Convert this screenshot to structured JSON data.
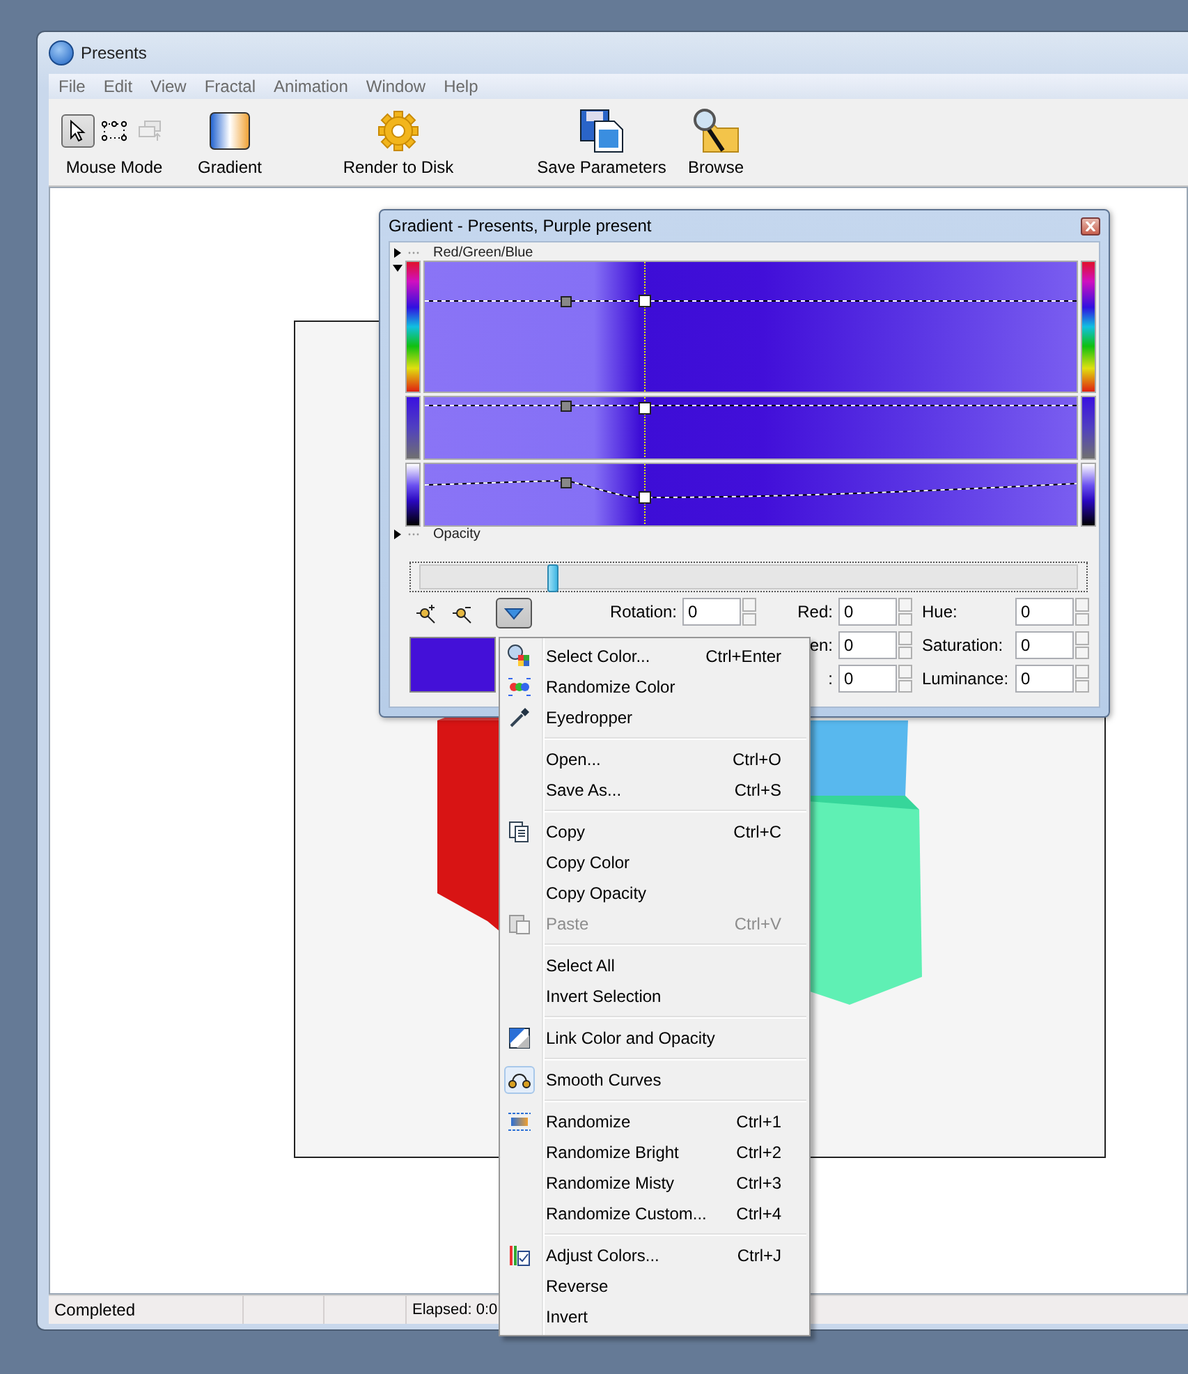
{
  "window": {
    "title": "Presents"
  },
  "menu_bar": [
    "File",
    "Edit",
    "View",
    "Fractal",
    "Animation",
    "Window",
    "Help"
  ],
  "toolbar": {
    "mouse_mode": {
      "label": "Mouse Mode",
      "tools": [
        {
          "selected": true,
          "disabled": false
        },
        {
          "selected": false,
          "disabled": false
        },
        {
          "selected": false,
          "disabled": true
        }
      ]
    },
    "buttons": [
      {
        "kind": "gradient",
        "label": "Gradient"
      },
      {
        "kind": "render",
        "label": "Render to Disk"
      },
      {
        "kind": "save",
        "label": "Save Parameters"
      },
      {
        "kind": "browse",
        "label": "Browse"
      }
    ]
  },
  "status_bar": {
    "status": "Completed",
    "elapsed": "Elapsed: 0:0"
  },
  "gradient_window": {
    "title": "Gradient - Presents, Purple present",
    "sections": [
      {
        "label": "Red/Green/Blue",
        "expanded": true
      },
      {
        "label": "Opacity",
        "expanded": false
      }
    ],
    "channels": [
      {
        "kind": "hue"
      },
      {
        "kind": "saturation"
      },
      {
        "kind": "luminance"
      }
    ],
    "position": {
      "level": 0.2
    },
    "menu_button": {
      "selected": true
    },
    "swatch": {
      "color": "#4410d8"
    },
    "transform_fields": [
      {
        "label": "Rotation:",
        "value": "0"
      }
    ],
    "rgb_fields": [
      {
        "label": "Red:",
        "value": "0"
      },
      {
        "label": "en:",
        "value": "0"
      },
      {
        "label": ":",
        "value": "0"
      }
    ],
    "hsl_fields": [
      {
        "label": "Hue:",
        "value": "0"
      },
      {
        "label": "Saturation:",
        "value": "0"
      },
      {
        "label": "Luminance:",
        "value": "0"
      }
    ]
  },
  "context_menu": {
    "groups": [
      [
        {
          "label": "Select Color...",
          "shortcut": "Ctrl+Enter",
          "disabled": false,
          "checked": false
        },
        {
          "label": "Randomize Color",
          "disabled": false,
          "checked": false
        },
        {
          "label": "Eyedropper",
          "disabled": false,
          "checked": false
        }
      ],
      [
        {
          "label": "Open...",
          "shortcut": "Ctrl+O",
          "disabled": false,
          "checked": false
        },
        {
          "label": "Save As...",
          "shortcut": "Ctrl+S",
          "disabled": false,
          "checked": false
        }
      ],
      [
        {
          "label": "Copy",
          "shortcut": "Ctrl+C",
          "disabled": false,
          "checked": false
        },
        {
          "label": "Copy Color",
          "disabled": false,
          "checked": false
        },
        {
          "label": "Copy Opacity",
          "disabled": false,
          "checked": false
        },
        {
          "label": "Paste",
          "shortcut": "Ctrl+V",
          "disabled": true,
          "checked": false
        }
      ],
      [
        {
          "label": "Select All",
          "disabled": false,
          "checked": false
        },
        {
          "label": "Invert Selection",
          "disabled": false,
          "checked": false
        }
      ],
      [
        {
          "label": "Link Color and Opacity",
          "disabled": false,
          "checked": false
        }
      ],
      [
        {
          "label": "Smooth Curves",
          "disabled": false,
          "checked": true
        }
      ],
      [
        {
          "label": "Randomize",
          "shortcut": "Ctrl+1",
          "disabled": false,
          "checked": false
        },
        {
          "label": "Randomize Bright",
          "shortcut": "Ctrl+2",
          "disabled": false,
          "checked": false
        },
        {
          "label": "Randomize Misty",
          "shortcut": "Ctrl+3",
          "disabled": false,
          "checked": false
        },
        {
          "label": "Randomize Custom...",
          "shortcut": "Ctrl+4",
          "disabled": false,
          "checked": false
        }
      ],
      [
        {
          "label": "Adjust Colors...",
          "shortcut": "Ctrl+J",
          "disabled": false,
          "checked": false
        },
        {
          "label": "Reverse",
          "disabled": false,
          "checked": false
        },
        {
          "label": "Invert",
          "disabled": false,
          "checked": false
        }
      ]
    ]
  }
}
